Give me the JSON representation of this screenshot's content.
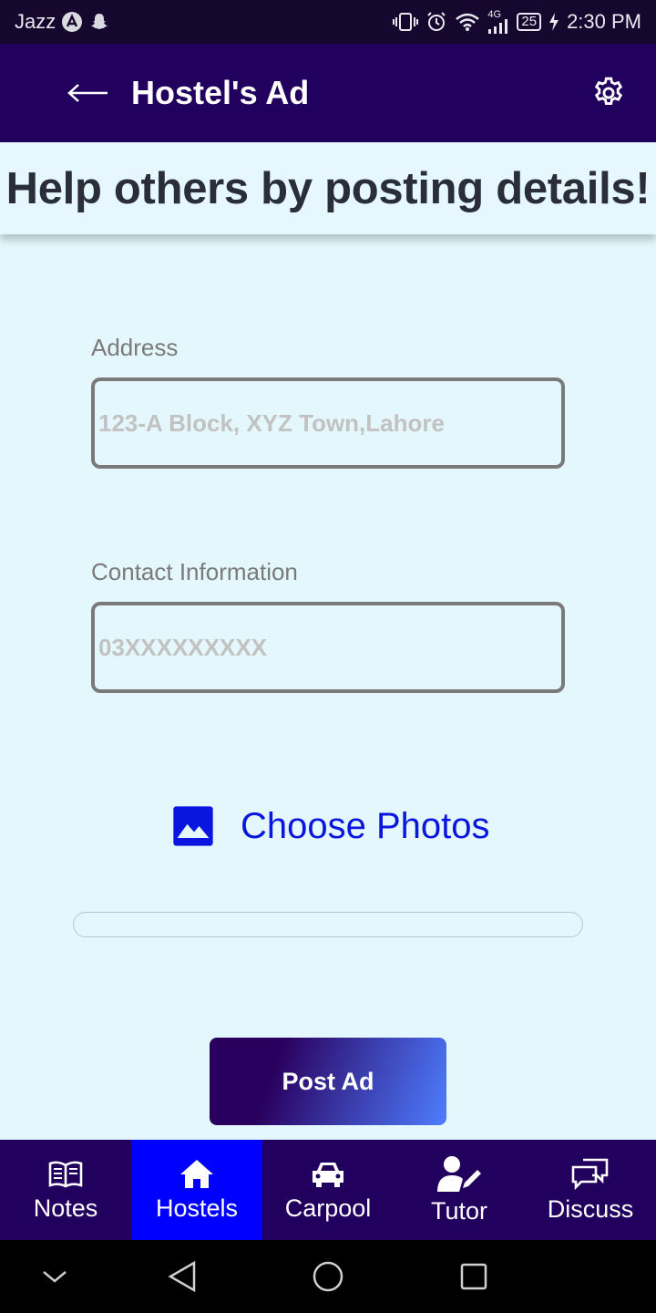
{
  "status_bar": {
    "carrier": "Jazz",
    "network": "4G",
    "battery": "25",
    "time": "2:30 PM",
    "icons": [
      "a-circle-icon",
      "snapchat-icon",
      "vibrate-icon",
      "alarm-icon",
      "wifi-icon",
      "signal-icon",
      "battery-icon",
      "charging-icon"
    ]
  },
  "app_bar": {
    "title": "Hostel's Ad",
    "back_icon": "arrow-left-icon",
    "settings_icon": "gear-icon"
  },
  "banner": {
    "text": "Help others by posting details!"
  },
  "form": {
    "address": {
      "label": "Address",
      "placeholder": "123-A Block, XYZ Town,Lahore",
      "value": ""
    },
    "contact": {
      "label": "Contact Information",
      "placeholder": "03XXXXXXXXX",
      "value": ""
    },
    "choose_photos": {
      "label": "Choose Photos",
      "icon": "image-icon"
    },
    "upload_progress": 0,
    "submit_label": "Post Ad"
  },
  "bottom_nav": {
    "items": [
      {
        "label": "Notes",
        "icon": "book-icon",
        "active": false
      },
      {
        "label": "Hostels",
        "icon": "home-icon",
        "active": true
      },
      {
        "label": "Carpool",
        "icon": "car-icon",
        "active": false
      },
      {
        "label": "Tutor",
        "icon": "user-edit-icon",
        "active": false
      },
      {
        "label": "Discuss",
        "icon": "comments-icon",
        "active": false
      }
    ]
  },
  "colors": {
    "app_bar": "#22005e",
    "background": "#e4f7fc",
    "accent_blue": "#0a16e0",
    "nav_active": "#0000ff"
  }
}
